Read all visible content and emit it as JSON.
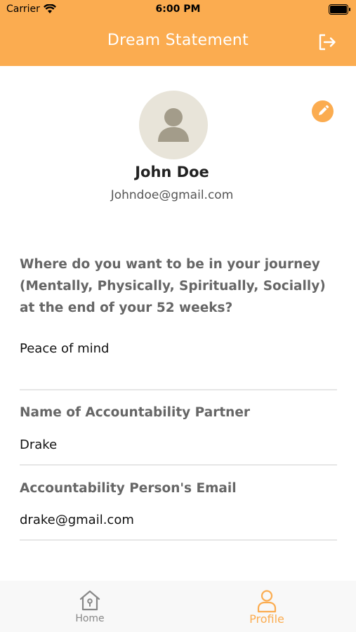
{
  "status_bar": {
    "carrier": "Carrier",
    "time": "6:00 PM"
  },
  "header": {
    "title": "Dream Statement",
    "logout_icon": "logout-icon",
    "background_color": "#FBAC50"
  },
  "profile": {
    "avatar_icon": "user-avatar-icon",
    "edit_icon": "pencil-icon",
    "name": "John Doe",
    "email": "Johndoe@gmail.com"
  },
  "form": {
    "question": "Where do you want to be in your journey (Mentally, Physically, Spiritually, Socially) at the end of your 52 weeks?",
    "answer": "Peace of mind",
    "partner_label": "Name of Accountability Partner",
    "partner_value": "Drake",
    "partner_email_label": "Accountability Person's Email",
    "partner_email_value": "drake@gmail.com"
  },
  "tabbar": {
    "tabs": [
      {
        "label": "Home",
        "icon": "home-icon",
        "active": false
      },
      {
        "label": "Profile",
        "icon": "person-icon",
        "active": true
      }
    ],
    "active_color": "#FBAC50",
    "inactive_color": "#888888"
  }
}
